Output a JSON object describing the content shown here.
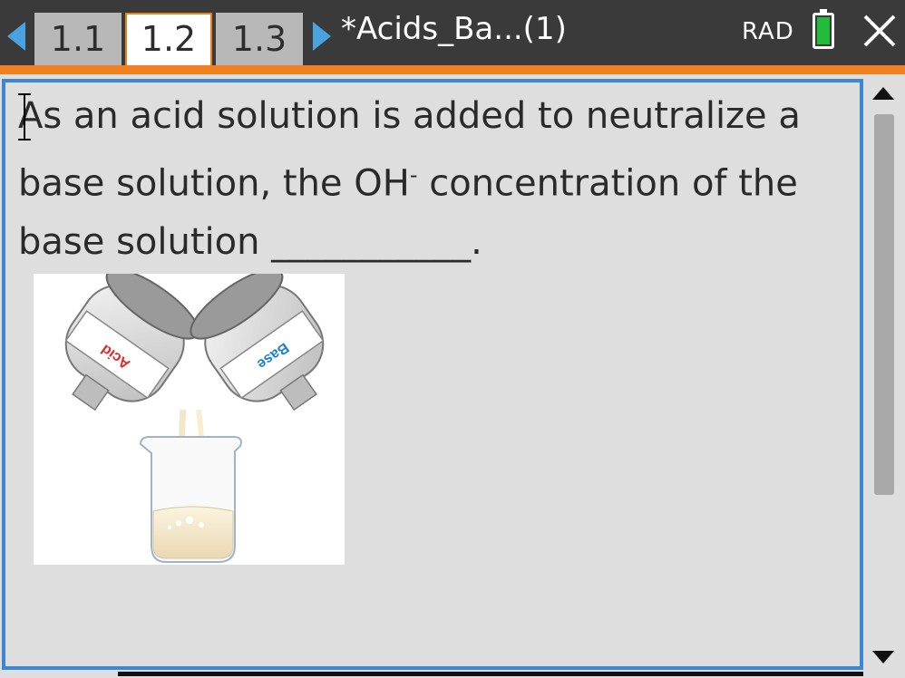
{
  "header": {
    "tabs": [
      {
        "label": "1.1"
      },
      {
        "label": "1.2"
      },
      {
        "label": "1.3"
      }
    ],
    "document_title": "*Acids_Ba...(1)",
    "angle_mode": "RAD",
    "battery_level": 1.0
  },
  "question": {
    "line1": "As an acid solution is added to neutralize a",
    "line2_pre": "base solution, the OH",
    "superscript": "-",
    "line2_post": " concentration of the",
    "line3": "base solution ___________."
  },
  "illustration": {
    "acid_label": "Acid",
    "base_label": "Base"
  },
  "colors": {
    "accent_orange": "#f07f1f",
    "accent_blue": "#3b87d6",
    "nav_arrow_blue": "#4aa3df",
    "battery_green": "#1fbd3a",
    "acid_red": "#e02a2a",
    "base_blue": "#1f7fd0"
  }
}
